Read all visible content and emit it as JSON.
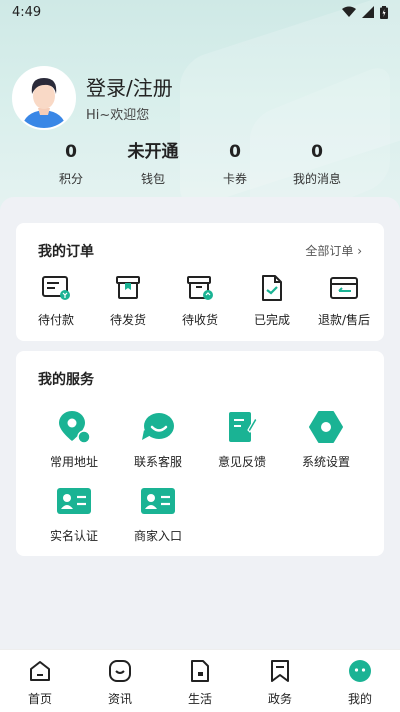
{
  "status_bar": {
    "time": "4:49"
  },
  "profile": {
    "login_text": "登录/注册",
    "welcome_text": "Hi~欢迎您"
  },
  "stats": [
    {
      "value": "0",
      "label": "积分"
    },
    {
      "value": "未开通",
      "label": "钱包"
    },
    {
      "value": "0",
      "label": "卡券"
    },
    {
      "value": "0",
      "label": "我的消息"
    }
  ],
  "orders": {
    "title": "我的订单",
    "all_link": "全部订单",
    "items": [
      {
        "label": "待付款",
        "icon": "pending-payment-icon"
      },
      {
        "label": "待发货",
        "icon": "pending-shipment-icon"
      },
      {
        "label": "待收货",
        "icon": "pending-receipt-icon"
      },
      {
        "label": "已完成",
        "icon": "completed-icon"
      },
      {
        "label": "退款/售后",
        "icon": "refund-icon"
      }
    ]
  },
  "services": {
    "title": "我的服务",
    "items": [
      {
        "label": "常用地址",
        "icon": "location-icon"
      },
      {
        "label": "联系客服",
        "icon": "customer-service-icon"
      },
      {
        "label": "意见反馈",
        "icon": "feedback-icon"
      },
      {
        "label": "系统设置",
        "icon": "settings-icon"
      },
      {
        "label": "实名认证",
        "icon": "id-card-icon"
      },
      {
        "label": "商家入口",
        "icon": "merchant-icon"
      }
    ]
  },
  "tabbar": [
    {
      "label": "首页",
      "icon": "home-icon"
    },
    {
      "label": "资讯",
      "icon": "news-icon"
    },
    {
      "label": "生活",
      "icon": "life-icon"
    },
    {
      "label": "政务",
      "icon": "government-icon"
    },
    {
      "label": "我的",
      "icon": "profile-icon",
      "active": true
    }
  ],
  "colors": {
    "accent": "#1ab394",
    "header_bg": "#d4ecea",
    "text": "#222222"
  }
}
